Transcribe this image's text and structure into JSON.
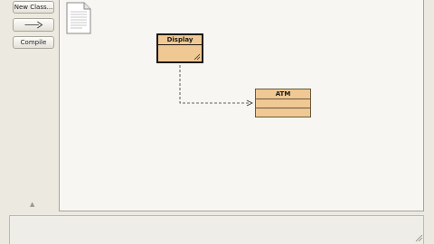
{
  "toolbar": {
    "new_class_label": "New Class...",
    "arrow_tool_icon": "dependency-arrow-icon",
    "compile_label": "Compile",
    "collapse_icon": "collapse-up-icon",
    "collapse_glyph": "▲"
  },
  "canvas": {
    "note_icon": "readme-document-icon",
    "classes": [
      {
        "name": "Display",
        "selected": true
      },
      {
        "name": "ATM",
        "selected": false
      }
    ],
    "relations": [
      {
        "from": "Display",
        "to": "ATM",
        "style": "dashed-arrow"
      }
    ]
  },
  "status": {
    "message": ""
  },
  "colors": {
    "class_fill": "#f0c893",
    "canvas_bg": "#f7f6f2",
    "window_bg": "#ece9e1"
  }
}
